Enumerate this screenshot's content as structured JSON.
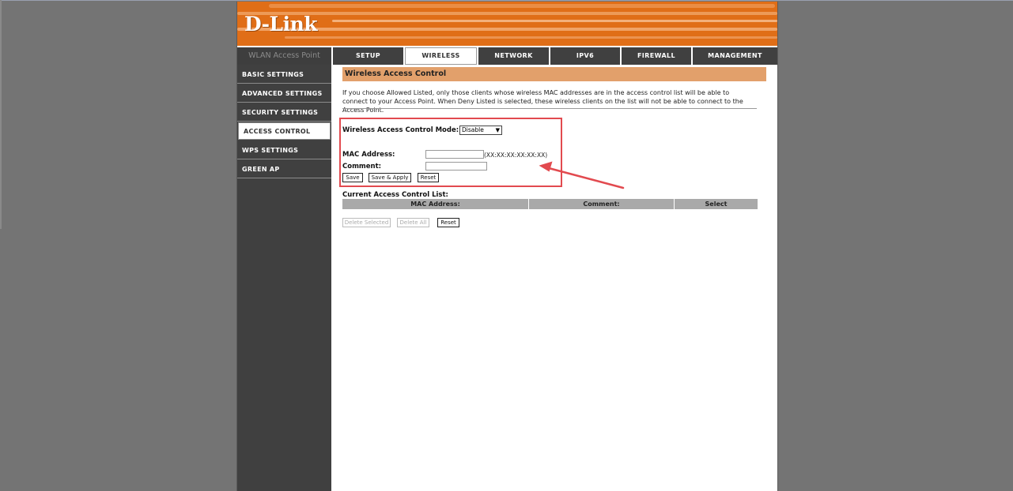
{
  "brand": {
    "logo": "D-Link",
    "product": "WLAN Access Point"
  },
  "nav": {
    "tabs": [
      {
        "label": "SETUP"
      },
      {
        "label": "WIRELESS"
      },
      {
        "label": "NETWORK"
      },
      {
        "label": "IPV6"
      },
      {
        "label": "FIREWALL"
      },
      {
        "label": "MANAGEMENT"
      }
    ],
    "active_tab": "WIRELESS"
  },
  "sidebar": {
    "items": [
      {
        "label": "BASIC SETTINGS"
      },
      {
        "label": "ADVANCED SETTINGS"
      },
      {
        "label": "SECURITY SETTINGS"
      },
      {
        "label": "ACCESS CONTROL"
      },
      {
        "label": "WPS SETTINGS"
      },
      {
        "label": "GREEN AP"
      }
    ],
    "active_item": "ACCESS CONTROL"
  },
  "page": {
    "title": "Wireless Access Control",
    "description": "If you choose Allowed Listed, only those clients whose wireless MAC addresses are in the access control list will be able to connect to your Access Point. When Deny Listed is selected, these wireless clients on the list will not be able to connect to the Access Point."
  },
  "form": {
    "mode_label": "Wireless Access Control Mode:",
    "mode_value": "Disable",
    "mac_label": "MAC Address:",
    "mac_value": "",
    "mac_hint": "(XX:XX:XX:XX:XX:XX)",
    "comment_label": "Comment:",
    "comment_value": "",
    "save_label": "Save",
    "save_apply_label": "Save & Apply",
    "reset_label": "Reset"
  },
  "acl": {
    "title": "Current Access Control List:",
    "columns": [
      "MAC Address:",
      "Comment:",
      "Select"
    ],
    "rows": [],
    "delete_selected_label": "Delete Selected",
    "delete_all_label": "Delete All",
    "reset_label": "Reset"
  },
  "colors": {
    "banner_orange": "#e06e17",
    "nav_dark": "#404040",
    "title_bar": "#e2a06b",
    "annotation_red": "#e24a4f"
  },
  "icons": {
    "select_chevron": "chevron-down-icon",
    "annotation_arrow": "arrow-icon"
  }
}
